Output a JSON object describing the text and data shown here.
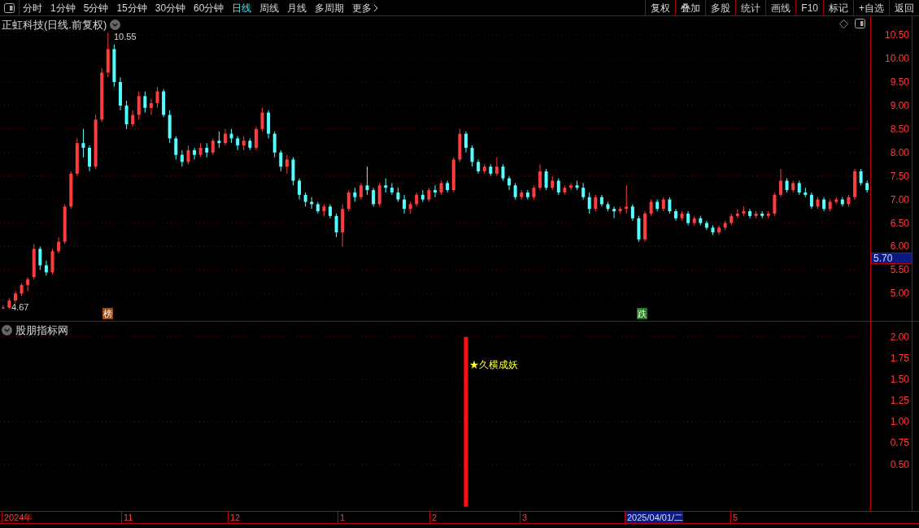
{
  "toolbar": {
    "periods": [
      {
        "label": "分时",
        "selected": false
      },
      {
        "label": "1分钟",
        "selected": false
      },
      {
        "label": "5分钟",
        "selected": false
      },
      {
        "label": "15分钟",
        "selected": false
      },
      {
        "label": "30分钟",
        "selected": false
      },
      {
        "label": "60分钟",
        "selected": false
      },
      {
        "label": "日线",
        "selected": true
      },
      {
        "label": "周线",
        "selected": false
      },
      {
        "label": "月线",
        "selected": false
      },
      {
        "label": "多周期",
        "selected": false
      }
    ],
    "more": "更多",
    "buttons": [
      "复权",
      "叠加",
      "多股",
      "统计",
      "画线",
      "F10",
      "标记",
      "+自选",
      "返回"
    ]
  },
  "main_chart": {
    "title": "正虹科技(日线.前复权)",
    "high_label": "10.55",
    "low_label": "4.67",
    "markers": [
      {
        "text": "榜",
        "color": "#9a4a10"
      },
      {
        "text": "跌",
        "color": "#1f7a1f"
      }
    ],
    "chart_data": {
      "type": "candlestick",
      "grid": true,
      "ylim": [
        4.4,
        10.9
      ],
      "yticks": [
        {
          "value": 10.5,
          "label": "10.50"
        },
        {
          "value": 10,
          "label": "10.00"
        },
        {
          "value": 9.5,
          "label": "9.50"
        },
        {
          "value": 9,
          "label": "9.00"
        },
        {
          "value": 8.5,
          "label": "8.50"
        },
        {
          "value": 8,
          "label": "8.00"
        },
        {
          "value": 7.5,
          "label": "7.50"
        },
        {
          "value": 7,
          "label": "7.00"
        },
        {
          "value": 6.5,
          "label": "6.50"
        },
        {
          "value": 6,
          "label": "6.00"
        },
        {
          "value": 5.5,
          "label": "5.50"
        },
        {
          "value": 5,
          "label": "5.00"
        }
      ],
      "categories": [
        null,
        null,
        null,
        null,
        null,
        null,
        null,
        null,
        null,
        null,
        null,
        null,
        null,
        null,
        null,
        null,
        null,
        null,
        null,
        null,
        null,
        null,
        null,
        null,
        null,
        null,
        null,
        null,
        null,
        null,
        null,
        null,
        null,
        null,
        null,
        null,
        null,
        null,
        null,
        null,
        null,
        null,
        null,
        null,
        null,
        null,
        null,
        null,
        null,
        null,
        null,
        null,
        null,
        null,
        null,
        null,
        null,
        null,
        null,
        null,
        null,
        null,
        null,
        null,
        null,
        null,
        null,
        null,
        null,
        null,
        null,
        null,
        null,
        null,
        null,
        null,
        null,
        null,
        null,
        null,
        null,
        null,
        null,
        null,
        null,
        null,
        null,
        null,
        null,
        null,
        null,
        null,
        null,
        null,
        null,
        null,
        null,
        null,
        null,
        null,
        null,
        null,
        null,
        null,
        null,
        null,
        null,
        null,
        null,
        null,
        null,
        null,
        null,
        null,
        null,
        null,
        null,
        null,
        null,
        null,
        null,
        null,
        null,
        null,
        null,
        null,
        null,
        null,
        null,
        null,
        null,
        null,
        null,
        null,
        null,
        null,
        null,
        null,
        null,
        null,
        null
      ],
      "ohlc": [
        [
          4.68,
          4.75,
          4.67,
          4.7
        ],
        [
          4.7,
          4.9,
          4.67,
          4.85
        ],
        [
          4.85,
          5.05,
          4.8,
          5.0
        ],
        [
          5.0,
          5.22,
          4.95,
          5.18
        ],
        [
          5.18,
          5.35,
          5.05,
          5.3
        ],
        [
          5.35,
          6.05,
          5.3,
          5.95
        ],
        [
          5.95,
          6.0,
          5.5,
          5.6
        ],
        [
          5.6,
          5.7,
          5.38,
          5.45
        ],
        [
          5.45,
          5.95,
          5.4,
          5.9
        ],
        [
          5.9,
          6.2,
          5.85,
          6.1
        ],
        [
          6.1,
          6.9,
          6.05,
          6.85
        ],
        [
          6.85,
          7.6,
          6.8,
          7.55
        ],
        [
          7.55,
          8.3,
          7.5,
          8.2
        ],
        [
          8.2,
          8.5,
          7.9,
          8.1
        ],
        [
          8.1,
          8.15,
          7.6,
          7.7
        ],
        [
          7.7,
          8.8,
          7.65,
          8.7
        ],
        [
          8.7,
          9.8,
          8.65,
          9.7
        ],
        [
          9.7,
          10.55,
          9.6,
          10.2
        ],
        [
          10.2,
          10.3,
          9.4,
          9.5
        ],
        [
          9.5,
          9.6,
          8.9,
          9.0
        ],
        [
          9.0,
          9.1,
          8.5,
          8.6
        ],
        [
          8.6,
          8.9,
          8.55,
          8.8
        ],
        [
          8.8,
          9.3,
          8.7,
          9.2
        ],
        [
          9.2,
          9.3,
          8.85,
          8.95
        ],
        [
          8.95,
          9.15,
          8.8,
          9.05
        ],
        [
          9.05,
          9.4,
          8.95,
          9.3
        ],
        [
          9.3,
          9.35,
          8.75,
          8.8
        ],
        [
          8.8,
          8.9,
          8.2,
          8.3
        ],
        [
          8.3,
          8.35,
          7.85,
          7.95
        ],
        [
          7.95,
          8.05,
          7.7,
          7.8
        ],
        [
          7.8,
          8.15,
          7.75,
          8.05
        ],
        [
          8.05,
          8.1,
          7.85,
          7.95
        ],
        [
          7.95,
          8.2,
          7.9,
          8.1
        ],
        [
          8.1,
          8.2,
          7.9,
          8.0
        ],
        [
          8.0,
          8.3,
          7.95,
          8.25
        ],
        [
          8.25,
          8.45,
          8.1,
          8.2
        ],
        [
          8.2,
          8.5,
          8.15,
          8.4
        ],
        [
          8.4,
          8.5,
          8.2,
          8.3
        ],
        [
          8.3,
          8.35,
          8.05,
          8.15
        ],
        [
          8.15,
          8.35,
          8.05,
          8.25
        ],
        [
          8.25,
          8.3,
          8.05,
          8.1
        ],
        [
          8.1,
          8.55,
          8.05,
          8.5
        ],
        [
          8.5,
          8.95,
          8.45,
          8.85
        ],
        [
          8.85,
          8.9,
          8.3,
          8.4
        ],
        [
          8.4,
          8.45,
          7.9,
          8.0
        ],
        [
          8.0,
          8.05,
          7.6,
          7.7
        ],
        [
          7.7,
          7.95,
          7.55,
          7.85
        ],
        [
          7.85,
          7.9,
          7.3,
          7.4
        ],
        [
          7.4,
          7.45,
          7.0,
          7.1
        ],
        [
          7.1,
          7.15,
          6.85,
          6.95
        ],
        [
          6.95,
          7.05,
          6.8,
          6.9
        ],
        [
          6.9,
          6.95,
          6.7,
          6.75
        ],
        [
          6.75,
          6.9,
          6.65,
          6.85
        ],
        [
          6.85,
          6.9,
          6.6,
          6.65
        ],
        [
          6.65,
          6.7,
          6.2,
          6.3
        ],
        [
          6.3,
          6.9,
          6.0,
          6.8
        ],
        [
          6.8,
          7.2,
          6.75,
          7.15
        ],
        [
          7.15,
          7.25,
          6.95,
          7.05
        ],
        [
          7.05,
          7.35,
          7.0,
          7.3
        ],
        [
          7.3,
          7.7,
          7.1,
          7.2
        ],
        [
          7.2,
          7.25,
          6.85,
          6.9
        ],
        [
          6.9,
          7.35,
          6.85,
          7.3
        ],
        [
          7.3,
          7.45,
          7.15,
          7.25
        ],
        [
          7.25,
          7.35,
          7.1,
          7.15
        ],
        [
          7.15,
          7.25,
          6.95,
          7.0
        ],
        [
          7.0,
          7.1,
          6.7,
          6.8
        ],
        [
          6.8,
          6.95,
          6.7,
          6.9
        ],
        [
          6.9,
          7.15,
          6.85,
          7.1
        ],
        [
          7.1,
          7.2,
          6.95,
          7.0
        ],
        [
          7.0,
          7.25,
          6.95,
          7.2
        ],
        [
          7.2,
          7.3,
          7.05,
          7.15
        ],
        [
          7.15,
          7.4,
          7.1,
          7.35
        ],
        [
          7.35,
          7.4,
          7.15,
          7.2
        ],
        [
          7.2,
          7.9,
          7.15,
          7.85
        ],
        [
          7.85,
          8.5,
          7.8,
          8.4
        ],
        [
          8.4,
          8.45,
          8.0,
          8.1
        ],
        [
          8.1,
          8.15,
          7.7,
          7.8
        ],
        [
          7.8,
          7.85,
          7.55,
          7.6
        ],
        [
          7.6,
          7.75,
          7.55,
          7.7
        ],
        [
          7.7,
          7.75,
          7.5,
          7.55
        ],
        [
          7.55,
          7.9,
          7.5,
          7.7
        ],
        [
          7.7,
          7.75,
          7.4,
          7.45
        ],
        [
          7.45,
          7.5,
          7.2,
          7.3
        ],
        [
          7.3,
          7.35,
          7.0,
          7.05
        ],
        [
          7.05,
          7.2,
          7.0,
          7.15
        ],
        [
          7.15,
          7.2,
          7.0,
          7.05
        ],
        [
          7.05,
          7.3,
          7.0,
          7.25
        ],
        [
          7.25,
          7.75,
          7.2,
          7.6
        ],
        [
          7.6,
          7.65,
          7.2,
          7.25
        ],
        [
          7.25,
          7.5,
          7.2,
          7.4
        ],
        [
          7.4,
          7.45,
          7.1,
          7.15
        ],
        [
          7.15,
          7.3,
          7.1,
          7.25
        ],
        [
          7.25,
          7.35,
          7.2,
          7.3
        ],
        [
          7.3,
          7.4,
          7.2,
          7.25
        ],
        [
          7.25,
          7.35,
          7.0,
          7.05
        ],
        [
          7.05,
          7.15,
          6.7,
          6.8
        ],
        [
          6.8,
          7.1,
          6.75,
          7.05
        ],
        [
          7.05,
          7.1,
          6.85,
          6.9
        ],
        [
          6.9,
          6.95,
          6.75,
          6.8
        ],
        [
          6.8,
          6.85,
          6.6,
          6.75
        ],
        [
          6.75,
          6.85,
          6.7,
          6.8
        ],
        [
          6.8,
          7.3,
          6.7,
          6.85
        ],
        [
          6.85,
          6.9,
          6.55,
          6.6
        ],
        [
          6.6,
          6.65,
          6.1,
          6.15
        ],
        [
          6.15,
          6.75,
          6.1,
          6.7
        ],
        [
          6.7,
          7.0,
          6.65,
          6.95
        ],
        [
          6.95,
          7.0,
          6.75,
          6.8
        ],
        [
          6.8,
          7.05,
          6.75,
          7.0
        ],
        [
          7.0,
          7.05,
          6.7,
          6.75
        ],
        [
          6.75,
          6.8,
          6.55,
          6.6
        ],
        [
          6.6,
          6.75,
          6.55,
          6.7
        ],
        [
          6.7,
          6.75,
          6.45,
          6.5
        ],
        [
          6.5,
          6.65,
          6.45,
          6.6
        ],
        [
          6.6,
          6.65,
          6.45,
          6.5
        ],
        [
          6.5,
          6.55,
          6.35,
          6.4
        ],
        [
          6.4,
          6.45,
          6.25,
          6.3
        ],
        [
          6.3,
          6.45,
          6.25,
          6.4
        ],
        [
          6.4,
          6.55,
          6.35,
          6.5
        ],
        [
          6.5,
          6.7,
          6.45,
          6.65
        ],
        [
          6.65,
          6.8,
          6.6,
          6.7
        ],
        [
          6.7,
          6.85,
          6.65,
          6.75
        ],
        [
          6.75,
          6.8,
          6.6,
          6.65
        ],
        [
          6.65,
          6.75,
          6.6,
          6.7
        ],
        [
          6.7,
          6.75,
          6.6,
          6.65
        ],
        [
          6.65,
          6.75,
          6.6,
          6.7
        ],
        [
          6.7,
          7.15,
          6.65,
          7.1
        ],
        [
          7.1,
          7.65,
          7.05,
          7.4
        ],
        [
          7.4,
          7.45,
          7.15,
          7.2
        ],
        [
          7.2,
          7.4,
          7.15,
          7.35
        ],
        [
          7.35,
          7.4,
          7.1,
          7.15
        ],
        [
          7.15,
          7.25,
          7.05,
          7.1
        ],
        [
          7.1,
          7.15,
          6.8,
          6.85
        ],
        [
          6.85,
          7.05,
          6.8,
          7.0
        ],
        [
          7.0,
          7.05,
          6.75,
          6.8
        ],
        [
          6.8,
          7.0,
          6.75,
          6.95
        ],
        [
          6.95,
          7.05,
          6.9,
          7.0
        ],
        [
          7.0,
          7.05,
          6.85,
          6.9
        ],
        [
          6.9,
          7.1,
          6.85,
          7.05
        ],
        [
          7.05,
          7.65,
          7.0,
          7.6
        ],
        [
          7.6,
          7.65,
          7.3,
          7.35
        ],
        [
          7.35,
          7.4,
          7.15,
          7.2
        ]
      ]
    }
  },
  "price_axis": {
    "current_price": "5.70"
  },
  "indicator": {
    "title": "股朋指标网",
    "signal_label": "★久横成妖",
    "chart_data": {
      "type": "bar",
      "grid": true,
      "ylim": [
        -0.05,
        2.18
      ],
      "yticks": [
        {
          "value": 2,
          "label": "2.00"
        },
        {
          "value": 1.75,
          "label": "1.75"
        },
        {
          "value": 1.5,
          "label": "1.50"
        },
        {
          "value": 1.25,
          "label": "1.25"
        },
        {
          "value": 1,
          "label": "1.00"
        },
        {
          "value": 0.75,
          "label": "0.75"
        },
        {
          "value": 0.5,
          "label": "0.50"
        }
      ],
      "categories": [
        null,
        null,
        null,
        null,
        null,
        null,
        null,
        null,
        null,
        null,
        null,
        null,
        null,
        null,
        null,
        null,
        null,
        null,
        null,
        null,
        null,
        null,
        null,
        null,
        null,
        null,
        null,
        null,
        null,
        null,
        null,
        null,
        null,
        null,
        null,
        null,
        null,
        null,
        null,
        null,
        null,
        null,
        null,
        null,
        null,
        null,
        null,
        null,
        null,
        null,
        null,
        null,
        null,
        null,
        null,
        null,
        null,
        null,
        null,
        null,
        null,
        null,
        null,
        null,
        null,
        null,
        null,
        null,
        null,
        null,
        null,
        null,
        null,
        null,
        null,
        null,
        null,
        null,
        null,
        null,
        null,
        null,
        null,
        null,
        null,
        null,
        null,
        null,
        null,
        null,
        null,
        null,
        null,
        null,
        null,
        null,
        null,
        null,
        null,
        null,
        null,
        null,
        null,
        null,
        null,
        null,
        null,
        null,
        null,
        null,
        null,
        null,
        null,
        null,
        null,
        null,
        null,
        null,
        null,
        null,
        null,
        null,
        null,
        null,
        null,
        null,
        null,
        null,
        null,
        null,
        null,
        null,
        null,
        null,
        null,
        null,
        null,
        null,
        null,
        null,
        null
      ],
      "values": [
        null,
        null,
        null,
        null,
        null,
        null,
        null,
        null,
        null,
        null,
        null,
        null,
        null,
        null,
        null,
        null,
        null,
        null,
        null,
        null,
        null,
        null,
        null,
        null,
        null,
        null,
        null,
        null,
        null,
        null,
        null,
        null,
        null,
        null,
        null,
        null,
        null,
        null,
        null,
        null,
        null,
        null,
        null,
        null,
        null,
        null,
        null,
        null,
        null,
        null,
        null,
        null,
        null,
        null,
        null,
        null,
        null,
        null,
        null,
        null,
        null,
        null,
        null,
        null,
        null,
        null,
        null,
        null,
        null,
        null,
        null,
        null,
        null,
        null,
        null,
        2,
        null,
        null,
        null,
        null,
        null,
        null,
        null,
        null,
        null,
        null,
        null,
        null,
        null,
        null,
        null,
        null,
        null,
        null,
        null,
        null,
        null,
        null,
        null,
        null,
        null,
        null,
        null,
        null,
        null,
        null,
        null,
        null,
        null,
        null,
        null,
        null,
        null,
        null,
        null,
        null,
        null,
        null,
        null,
        null,
        null,
        null,
        null,
        null,
        null,
        null,
        null,
        null,
        null,
        null,
        null,
        null,
        null,
        null,
        null,
        null,
        null,
        null,
        null,
        null,
        null
      ]
    }
  },
  "time_axis": {
    "labels": [
      {
        "text": "2024年",
        "selected": false
      },
      {
        "text": "11",
        "selected": false
      },
      {
        "text": "12",
        "selected": false
      },
      {
        "text": "1",
        "selected": false
      },
      {
        "text": "2",
        "selected": false
      },
      {
        "text": "3",
        "selected": false
      },
      {
        "text": "2025/04/01/二",
        "selected": true
      },
      {
        "text": "5",
        "selected": false
      }
    ]
  }
}
